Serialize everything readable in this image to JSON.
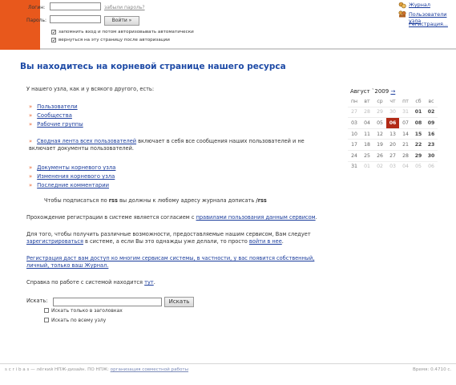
{
  "login": {
    "login_label": "Логин:",
    "password_label": "Пароль:",
    "forgot_link": "забыли пароль?",
    "submit_label": "Войти »",
    "remember_label": "запомнить вход и потом авторизовывать автоматически",
    "return_label": "вернуться на эту страницу после авторизации"
  },
  "quicklinks": {
    "journal": "Журнал",
    "node_users": "Пользователи узла",
    "registration": "Регистрация..."
  },
  "main": {
    "title": "Вы находитесь на корневой странице нашего ресурса",
    "intro": "У нашего узла, как и у всякого другого, есть:",
    "links1": [
      "Пользователи",
      "Сообщества",
      "Рабочие группы"
    ],
    "feed_link": "Сводная лента всех пользователей",
    "feed_rest": " включает в себя все сообщения наших пользователей и не включает документы пользователей.",
    "links2": [
      "Документы корневого узла",
      "Изменения корневого узла",
      "Последние комментарии"
    ],
    "rss_a": "Чтобы подписаться по ",
    "rss_b": "rss",
    "rss_c": " вы должны к любому адресу журнала дописать ",
    "rss_d": "/rss",
    "terms_a": "Прохождение регистрации в системе является согласием с ",
    "terms_link": "правилами пользования данным сервисом",
    "terms_b": ".",
    "reg_a": "Для того, чтобы получить различные возможности, предоставляемые нашим сервисом, Вам следует ",
    "reg_link": "зарегистрироваться",
    "reg_b": " в системе, а если Вы это однажды уже делали, то просто ",
    "login_link": "войти в нее",
    "reg_c": ".",
    "promo_link": "Регистрация даст вам доступ ко многим сервисам системы, в частности, у вас появится собственный, личный, только ваш Журнал.",
    "help_a": "Справка по работе с системой находится ",
    "help_link": "тут",
    "help_b": "."
  },
  "calendar": {
    "title": "Август `2009",
    "next_arrow": "→",
    "weekdays": [
      "пн",
      "вт",
      "ср",
      "чт",
      "пт",
      "сб",
      "вс"
    ],
    "weeks": [
      [
        "27",
        "28",
        "29",
        "30",
        "31",
        "01",
        "02"
      ],
      [
        "03",
        "04",
        "05",
        "06",
        "07",
        "08",
        "09"
      ],
      [
        "10",
        "11",
        "12",
        "13",
        "14",
        "15",
        "16"
      ],
      [
        "17",
        "18",
        "19",
        "20",
        "21",
        "22",
        "23"
      ],
      [
        "24",
        "25",
        "26",
        "27",
        "28",
        "29",
        "30"
      ],
      [
        "31",
        "01",
        "02",
        "03",
        "04",
        "05",
        "06"
      ]
    ],
    "today": "06",
    "colors": {
      "today_bg": "#b22a16"
    }
  },
  "search": {
    "label": "Искать:",
    "button": "Искать",
    "opt_titles": "Искать только в заголовках",
    "opt_all_node": "Искать по всему узлу"
  },
  "footer": {
    "brand": "s c r i b a s",
    "text": " — лёгкий НПЖ-дизайн. ПО НПЖ: ",
    "link": "организация совместной работы",
    "time": "Время: 0.4710 с."
  },
  "colors": {
    "brand": "#e8581c",
    "link": "#1a3c9c",
    "title": "#1d4aa6"
  }
}
